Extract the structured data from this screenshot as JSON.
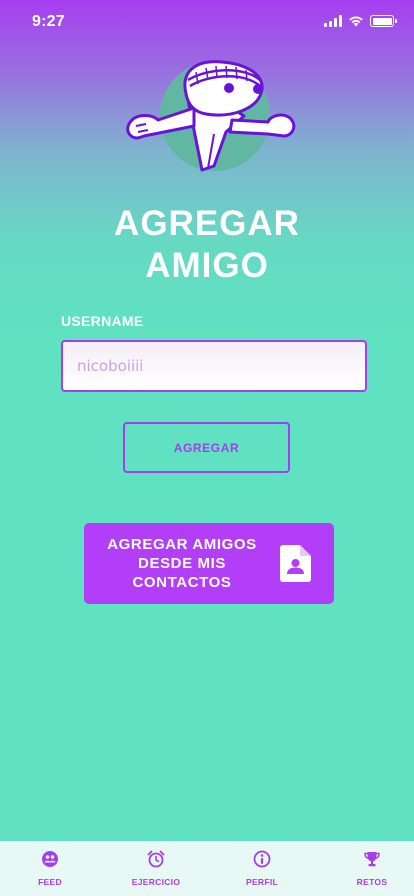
{
  "status_bar": {
    "time": "9:27",
    "icons": [
      "signal-icon",
      "wifi-icon",
      "battery-icon"
    ]
  },
  "mascot": {
    "icon": "runner-mascot-icon"
  },
  "page": {
    "title_line1": "AGREGAR",
    "title_line2": "AMIGO"
  },
  "form": {
    "username_label": "USERNAME",
    "username_value": "nicoboiiii",
    "add_button_label": "AGREGAR",
    "contacts_button_line1": "AGREGAR AMIGOS",
    "contacts_button_line2": "DESDE MIS",
    "contacts_button_line3": "CONTACTOS",
    "contacts_icon": "contact-file-icon"
  },
  "tab_bar": {
    "tabs": [
      {
        "label": "FEED",
        "icon": "people-icon"
      },
      {
        "label": "EJERCICIO",
        "icon": "alarm-clock-icon"
      },
      {
        "label": "PERFIL",
        "icon": "info-icon"
      },
      {
        "label": "RETOS",
        "icon": "trophy-icon"
      }
    ]
  },
  "colors": {
    "accent": "#a63ef0",
    "button_fill": "#b23ff7",
    "background_bottom": "#5fe1c2",
    "tab_bar": "#e8f8f4"
  }
}
